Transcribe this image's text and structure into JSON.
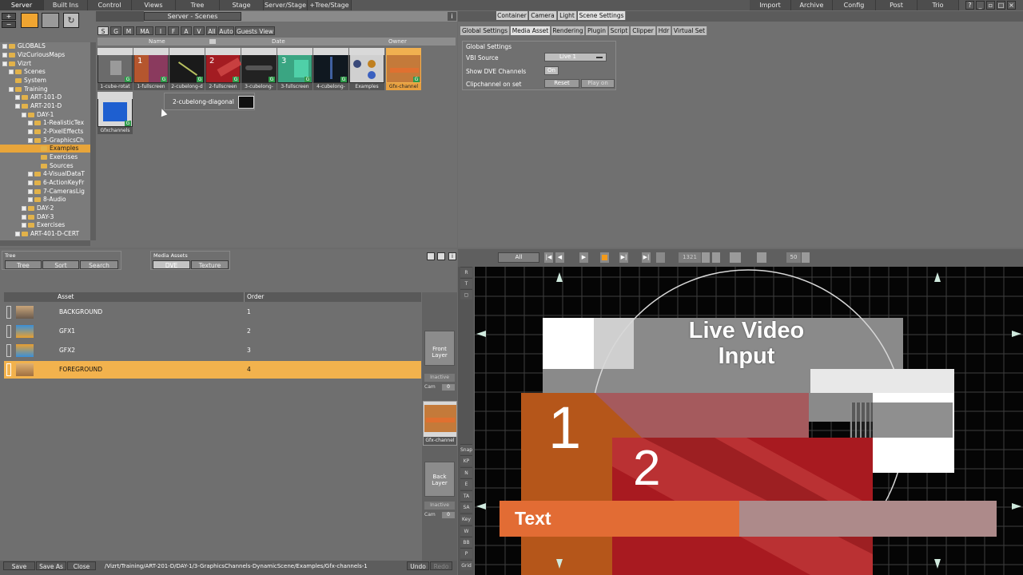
{
  "menubar": {
    "tabs": [
      "Server",
      "Built Ins",
      "Control",
      "Views",
      "Tree",
      "Stage",
      "Server/Stage",
      "+Tree/Stage"
    ],
    "right_tabs": [
      "Import",
      "Archive",
      "Config",
      "Post",
      "Trio"
    ]
  },
  "server_panel": {
    "title": "Server - Scenes",
    "filters": [
      "S",
      "G",
      "M",
      "MA",
      "I",
      "F",
      "A",
      "V",
      "All",
      "Auto",
      "Guests View"
    ],
    "columns": [
      "Name",
      "Date",
      "Owner"
    ]
  },
  "tree": {
    "nodes": [
      {
        "label": "GLOBALS",
        "level": 0
      },
      {
        "label": "VizCuriousMaps",
        "level": 0
      },
      {
        "label": "Vizrt",
        "level": 0
      },
      {
        "label": "Scenes",
        "level": 1
      },
      {
        "label": "System",
        "level": 1
      },
      {
        "label": "Training",
        "level": 1
      },
      {
        "label": "ART-101-D",
        "level": 2
      },
      {
        "label": "ART-201-D",
        "level": 2
      },
      {
        "label": "DAY-1",
        "level": 3
      },
      {
        "label": "1-RealisticTex",
        "level": 4
      },
      {
        "label": "2-PixelEffects",
        "level": 4
      },
      {
        "label": "3-GraphicsCh",
        "level": 4
      },
      {
        "label": "Examples",
        "level": 5,
        "selected": true
      },
      {
        "label": "Exercises",
        "level": 5
      },
      {
        "label": "Sources",
        "level": 5
      },
      {
        "label": "4-VisualDataT",
        "level": 4
      },
      {
        "label": "6-ActionKeyFr",
        "level": 4
      },
      {
        "label": "7-CamerasLig",
        "level": 4
      },
      {
        "label": "8-Audio",
        "level": 4
      },
      {
        "label": "DAY-2",
        "level": 3
      },
      {
        "label": "DAY-3",
        "level": 3
      },
      {
        "label": "Exercises",
        "level": 3
      },
      {
        "label": "ART-401-D-CERT",
        "level": 2
      }
    ]
  },
  "thumbs": [
    {
      "label": "1-cube-rotat",
      "color": "#6b6b6b"
    },
    {
      "label": "1-fullscreen",
      "color": "#b5562e",
      "num": "1"
    },
    {
      "label": "2-cubelong-d",
      "color": "#1a1a1a"
    },
    {
      "label": "2-fullscreen",
      "color": "#a31c22",
      "num": "2"
    },
    {
      "label": "3-cubelong-",
      "color": "#222"
    },
    {
      "label": "3-fullscreen",
      "color": "#3aa582",
      "num": "3"
    },
    {
      "label": "4-cubelong-",
      "color": "#101820"
    },
    {
      "label": "Examples",
      "color": "#3a4a7a"
    },
    {
      "label": "Gfx-channel",
      "color": "#c47a3a",
      "selected": true
    },
    {
      "label": "Gfxchannels",
      "color": "#1e5fd0"
    }
  ],
  "drag_tooltip": "2-cubelong-diagonal",
  "scene_settings": {
    "tabs": [
      "Container",
      "Camera",
      "Light",
      "Scene Settings"
    ],
    "subtabs": [
      "Global Settings",
      "Media Asset",
      "Rendering",
      "Plugin",
      "Script",
      "Clipper",
      "Hdr",
      "Virtual Set"
    ],
    "group_title": "Global Settings",
    "vbi_label": "VBI Source",
    "vbi_value": "Live 1",
    "dve_label": "Show DVE Channels",
    "dve_value": "On",
    "clip_label": "Clipchannel on set",
    "clip_reset": "Reset",
    "clip_play": "Play on"
  },
  "lower_left": {
    "tree_label": "Tree",
    "tree_buttons": [
      "Tree",
      "Sort",
      "Search"
    ],
    "media_label": "Media Assets",
    "media_buttons": [
      "DVE",
      "Texture"
    ],
    "columns": [
      "Asset",
      "Order"
    ],
    "rows": [
      {
        "asset": "BACKGROUND",
        "order": "1"
      },
      {
        "asset": "GFX1",
        "order": "2"
      },
      {
        "asset": "GFX2",
        "order": "3"
      },
      {
        "asset": "FOREGROUND",
        "order": "4",
        "selected": true
      }
    ],
    "front_layer": "Front Layer",
    "back_layer": "Back Layer",
    "inactive": "Inactive",
    "cam": "Cam",
    "cam_val": "0",
    "gfx_label": "Gfx-channel"
  },
  "render": {
    "all_label": "All",
    "frame": "1321",
    "fps": "50",
    "live_text": "Live Video",
    "input_text": "Input",
    "num1": "1",
    "num2": "2",
    "text_bar": "Text"
  },
  "sidetools": [
    "Snap",
    "KP",
    "N",
    "E",
    "TA",
    "SA",
    "Key",
    "W",
    "BB",
    "P",
    "Grid"
  ],
  "bottom": {
    "save": "Save",
    "save_as": "Save As",
    "close": "Close",
    "path": "/Vizrt/Training/ART-201-D/DAY-1/3-GraphicsChannels-DynamicScene/Examples/Gfx-channels-1",
    "undo": "Undo",
    "redo": "Redo"
  }
}
